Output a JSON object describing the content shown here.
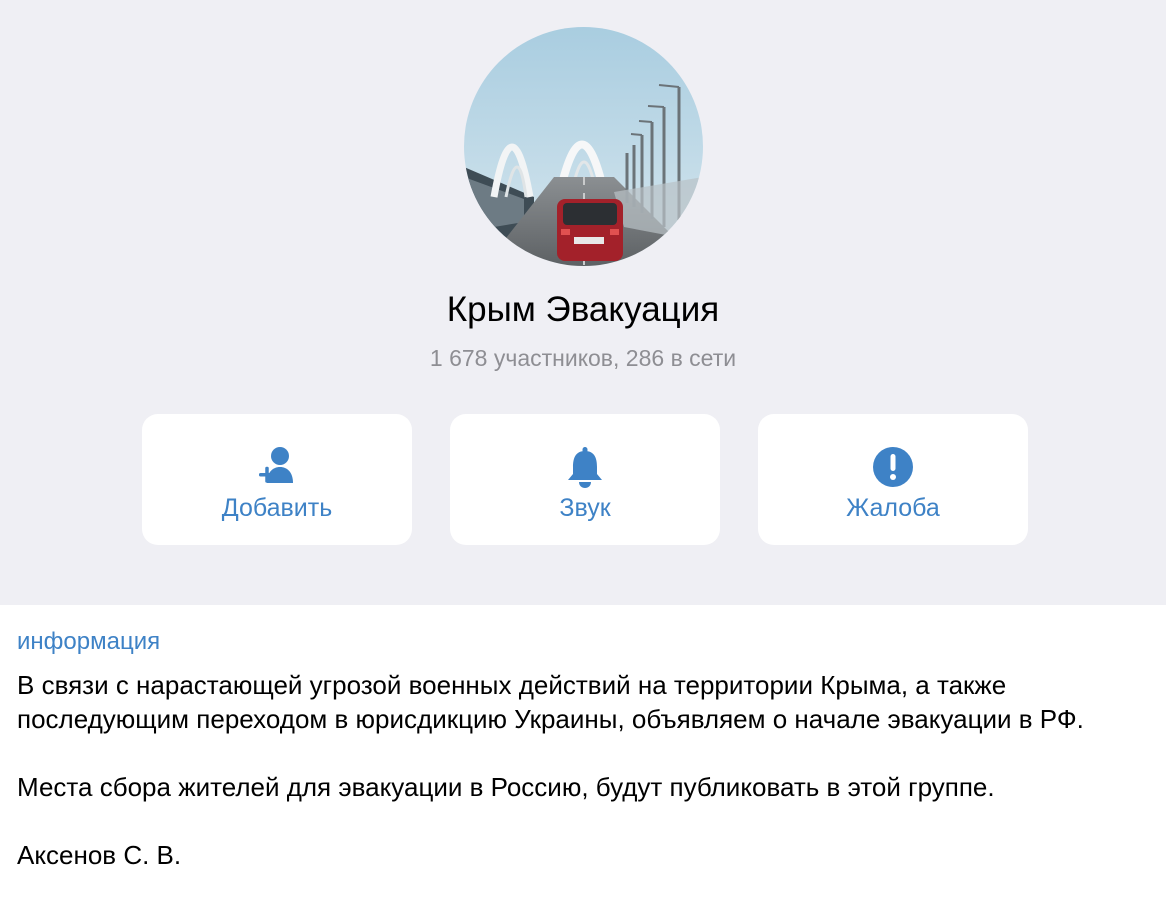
{
  "group": {
    "title": "Крым Эвакуация",
    "subtitle": "1 678 участников, 286 в сети",
    "avatar": "bridge-photo"
  },
  "actions": [
    {
      "label": "Добавить",
      "icon": "add-user-icon"
    },
    {
      "label": "Звук",
      "icon": "bell-icon"
    },
    {
      "label": "Жалоба",
      "icon": "exclamation-icon"
    }
  ],
  "info": {
    "label": "информация",
    "paragraphs": [
      "В связи с нарастающей угрозой военных действий на территории Крыма, а также последующим переходом в юрисдикцию Украины, объявляем о начале эвакуации в РФ.",
      "Места сбора жителей для эвакуации в Россию, будут публиковать в этой группе.",
      "Аксенов С. В."
    ]
  },
  "colors": {
    "accent": "#3e82c6",
    "header_bg": "#efeff4",
    "subtitle": "#8e8e93"
  }
}
